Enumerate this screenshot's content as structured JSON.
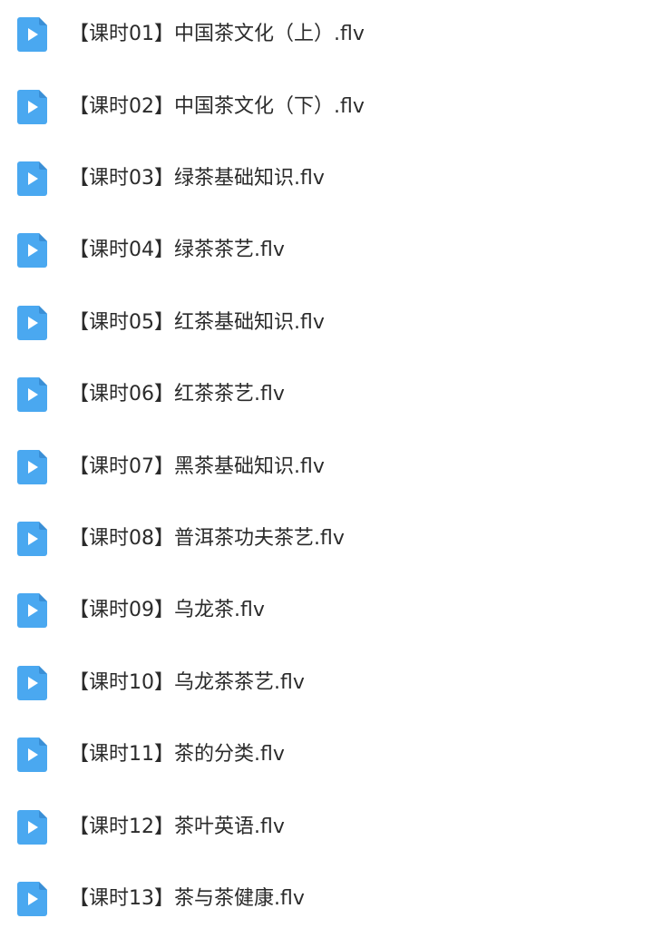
{
  "files": [
    {
      "name": "【课时01】中国茶文化（上）.flv",
      "icon": "video-file-icon"
    },
    {
      "name": "【课时02】中国茶文化（下）.flv",
      "icon": "video-file-icon"
    },
    {
      "name": "【课时03】绿茶基础知识.flv",
      "icon": "video-file-icon"
    },
    {
      "name": "【课时04】绿茶茶艺.flv",
      "icon": "video-file-icon"
    },
    {
      "name": "【课时05】红茶基础知识.flv",
      "icon": "video-file-icon"
    },
    {
      "name": "【课时06】红茶茶艺.flv",
      "icon": "video-file-icon"
    },
    {
      "name": "【课时07】黑茶基础知识.flv",
      "icon": "video-file-icon"
    },
    {
      "name": "【课时08】普洱茶功夫茶艺.flv",
      "icon": "video-file-icon"
    },
    {
      "name": "【课时09】乌龙茶.flv",
      "icon": "video-file-icon"
    },
    {
      "name": "【课时10】乌龙茶茶艺.flv",
      "icon": "video-file-icon"
    },
    {
      "name": "【课时11】茶的分类.flv",
      "icon": "video-file-icon"
    },
    {
      "name": "【课时12】茶叶英语.flv",
      "icon": "video-file-icon"
    },
    {
      "name": "【课时13】茶与茶健康.flv",
      "icon": "video-file-icon"
    }
  ],
  "colors": {
    "icon_blue": "#4aa8f0",
    "icon_blue_dark": "#3a8fd6",
    "text": "#2b2b2b"
  }
}
